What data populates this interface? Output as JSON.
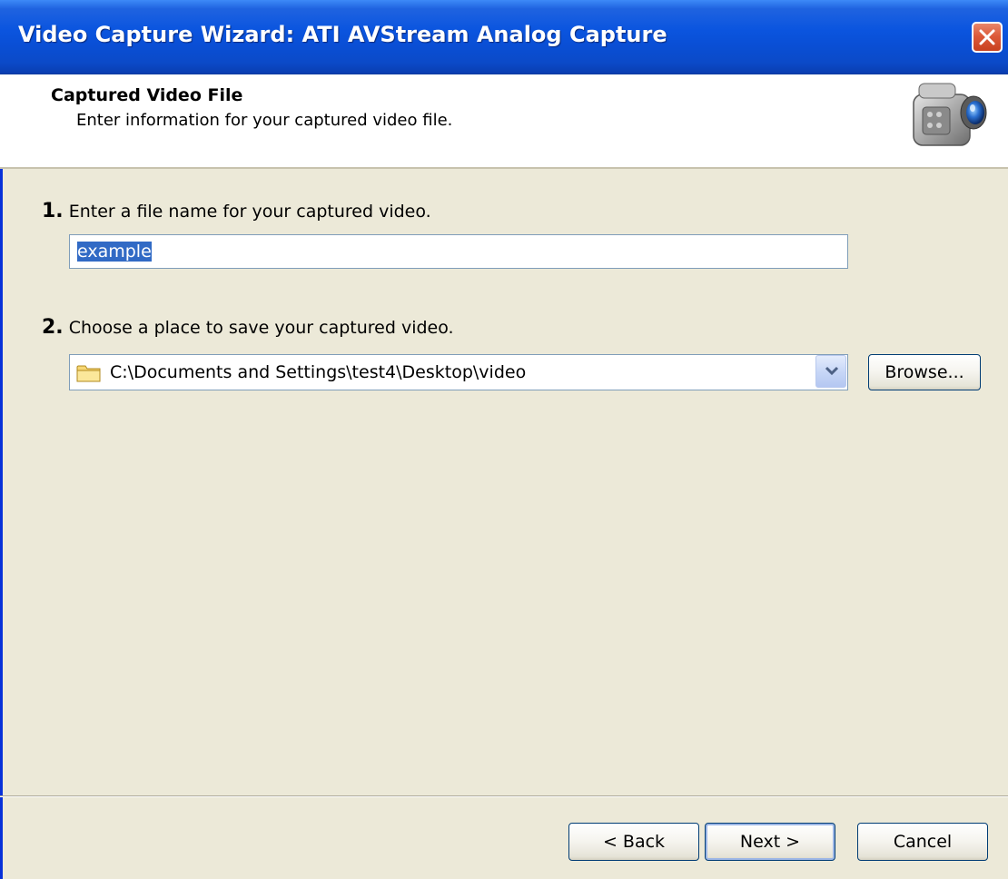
{
  "window": {
    "title": "Video Capture Wizard: ATI AVStream Analog Capture"
  },
  "header": {
    "title": "Captured Video File",
    "subtitle": "Enter information for your captured video file."
  },
  "step1": {
    "number": "1.",
    "label": "Enter a file name for your captured video.",
    "filename_value": "example"
  },
  "step2": {
    "number": "2.",
    "label": "Choose a place to save your captured video.",
    "location_value": "C:\\Documents and Settings\\test4\\Desktop\\video",
    "browse_label": "Browse..."
  },
  "footer": {
    "back_label": "< Back",
    "next_label": "Next >",
    "cancel_label": "Cancel"
  },
  "icons": {
    "close": "close-icon",
    "camera": "camcorder-icon",
    "folder": "folder-icon",
    "dropdown": "chevron-down-icon"
  },
  "colors": {
    "titlebar": "#0b55df",
    "close_button": "#dd5a3a",
    "selection": "#316ac5",
    "dialog_bg": "#ece9d8"
  }
}
